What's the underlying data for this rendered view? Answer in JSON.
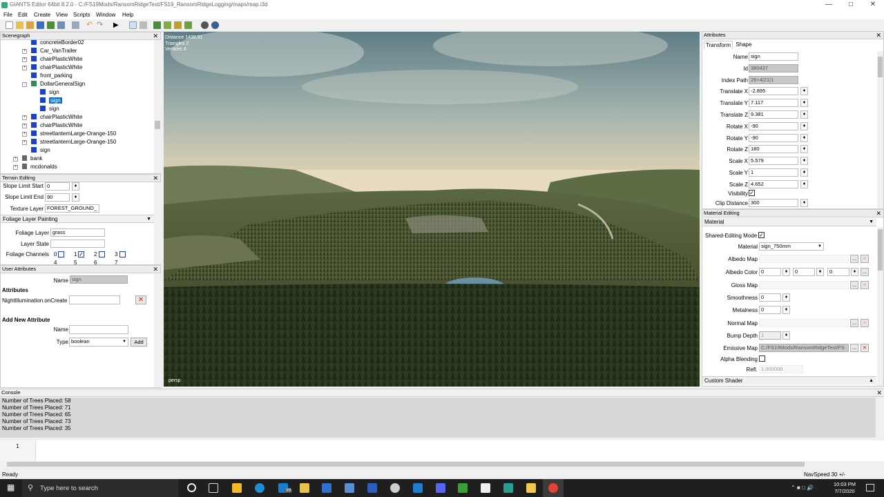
{
  "window": {
    "title": "GIANTS Editor 64bit 8.2.0 - C:/FS19Mods/RansomRidgeTest/FS19_RansomRidgeLogging/maps/map.i3d"
  },
  "menu": [
    "File",
    "Edit",
    "Create",
    "View",
    "Scripts",
    "Window",
    "Help"
  ],
  "scenegraph": {
    "title": "Scenegraph",
    "nodes": [
      {
        "label": "concreteBorder02"
      },
      {
        "label": "Car_VanTrailer"
      },
      {
        "label": "chairPlasticWhite"
      },
      {
        "label": "chairPlasticWhite"
      },
      {
        "label": "front_parking"
      },
      {
        "label": "DollarGeneralSign"
      },
      {
        "label": "sign"
      },
      {
        "label": "sign"
      },
      {
        "label": "sign"
      },
      {
        "label": "chairPlasticWhite"
      },
      {
        "label": "chairPlasticWhite"
      },
      {
        "label": "streetlanternLarge-Orange-150"
      },
      {
        "label": "streetlanternLarge-Orange-150"
      },
      {
        "label": "sign"
      },
      {
        "label": "bank"
      },
      {
        "label": "mcdonalds"
      }
    ]
  },
  "terrain": {
    "title": "Terrain Editing",
    "slope_start_label": "Slope Limit Start",
    "slope_start": "0",
    "slope_end_label": "Slope Limit End",
    "slope_end": "90",
    "texture_layer_label": "Texture Layer",
    "texture_layer": "FOREST_GROUND_",
    "foliage_title": "Foliage Layer Painting",
    "foliage_layer_label": "Foliage Layer",
    "foliage_layer": "grass",
    "layer_state_label": "Layer State",
    "layer_state": "",
    "channels_label": "Foliage Channels",
    "channels": [
      "0",
      "1",
      "2",
      "3"
    ],
    "channels2": [
      "4",
      "5",
      "6",
      "7"
    ]
  },
  "user_attributes": {
    "title": "User Attributes",
    "name_label": "Name",
    "name_value": "sign",
    "attributes_heading": "Attributes",
    "attr_name": "NightIllumination.onCreate",
    "add_heading": "Add New Attribute",
    "new_name_label": "Name",
    "new_name": "",
    "type_label": "Type",
    "type_value": "boolean",
    "add_button": "Add"
  },
  "viewport": {
    "stats": [
      "Distance 1438.91",
      "Triangles 2",
      "Vertices 4"
    ],
    "camera": "persp"
  },
  "attributes": {
    "title": "Attributes",
    "tabs": [
      "Transform",
      "Shape"
    ],
    "fields": [
      {
        "label": "Name",
        "value": "sign",
        "ro": false,
        "spin": false
      },
      {
        "label": "Id",
        "value": "380437",
        "ro": true,
        "spin": false
      },
      {
        "label": "Index Path",
        "value": "26>4|21|1",
        "ro": true,
        "spin": false
      },
      {
        "label": "Translate X",
        "value": "-2.895",
        "ro": false,
        "spin": true
      },
      {
        "label": "Translate Y",
        "value": "7.117",
        "ro": false,
        "spin": true
      },
      {
        "label": "Translate Z",
        "value": "9.381",
        "ro": false,
        "spin": true
      },
      {
        "label": "Rotate X",
        "value": "-90",
        "ro": false,
        "spin": true
      },
      {
        "label": "Rotate Y",
        "value": "-90",
        "ro": false,
        "spin": true
      },
      {
        "label": "Rotate Z",
        "value": "180",
        "ro": false,
        "spin": true
      },
      {
        "label": "Scale X",
        "value": "5.579",
        "ro": false,
        "spin": true
      },
      {
        "label": "Scale Y",
        "value": "1",
        "ro": false,
        "spin": true
      },
      {
        "label": "Scale Z",
        "value": "4.652",
        "ro": false,
        "spin": true
      }
    ],
    "visibility_label": "Visibility",
    "clip_label": "Clip Distance",
    "clip_value": "300"
  },
  "material": {
    "title": "Material Editing",
    "section": "Material",
    "shared_label": "Shared-Editing Mode",
    "material_label": "Material",
    "material_value": "sign_750mm",
    "albedo_map_label": "Albedo Map",
    "albedo_color_label": "Albedo Color",
    "albedo_color": [
      "0",
      "0",
      "0"
    ],
    "gloss_label": "Gloss Map",
    "smooth_label": "Smoothness",
    "smooth": "0",
    "metal_label": "Metalness",
    "metal": "0",
    "normal_label": "Normal Map",
    "bump_label": "Bump Depth",
    "bump": "1",
    "emissive_label": "Emissive Map",
    "emissive": "C:/FS19Mods/RansomRidgeTest/FS",
    "alpha_label": "Alpha Blending",
    "refl_label": "Refl.",
    "refl": "1.000000",
    "custom_shader": "Custom Shader"
  },
  "console": {
    "title": "Console",
    "lines": [
      "Number of Trees Placed: 58",
      "Number of Trees Placed: 71",
      "Number of Trees Placed: 65",
      "Number of Trees Placed: 73",
      "Number of Trees Placed: 35"
    ],
    "line_no": "1"
  },
  "status": {
    "left": "Ready",
    "right": "NavSpeed 30 +/-"
  },
  "taskbar": {
    "search": "Type here to search",
    "time": "10:03 PM",
    "date": "7/7/2020",
    "badge": "99"
  }
}
